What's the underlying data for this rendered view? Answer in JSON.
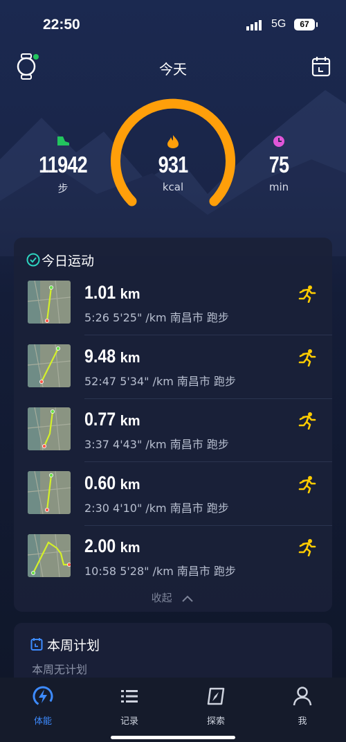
{
  "status_bar": {
    "time": "22:50",
    "network": "5G",
    "battery": "67"
  },
  "header": {
    "title": "今天",
    "left_icon": "watch-icon",
    "right_icon": "calendar-icon"
  },
  "stats": {
    "steps": {
      "value": "11942",
      "unit": "步",
      "color": "#22c55e"
    },
    "calories": {
      "value": "931",
      "unit": "kcal",
      "color": "#ff9f0a"
    },
    "minutes": {
      "value": "75",
      "unit": "min",
      "color": "#e056d8"
    },
    "ring_progress": 0.68
  },
  "today_card": {
    "title": "今日运动",
    "activities": [
      {
        "distance": "1.01",
        "unit": "km",
        "meta": "5:26  5'25\" /km 南昌市 跑步"
      },
      {
        "distance": "9.48",
        "unit": "km",
        "meta": "52:47  5'34\" /km 南昌市 跑步"
      },
      {
        "distance": "0.77",
        "unit": "km",
        "meta": "3:37  4'43\" /km 南昌市 跑步"
      },
      {
        "distance": "0.60",
        "unit": "km",
        "meta": "2:30  4'10\" /km 南昌市 跑步"
      },
      {
        "distance": "2.00",
        "unit": "km",
        "meta": "10:58  5'28\" /km 南昌市 跑步"
      }
    ],
    "collapse_label": "收起"
  },
  "plan_card": {
    "title": "本周计划",
    "subtitle": "本周无计划"
  },
  "tabbar": {
    "items": [
      {
        "label": "体能",
        "icon": "fitness-icon",
        "active": true
      },
      {
        "label": "记录",
        "icon": "list-icon",
        "active": false
      },
      {
        "label": "探索",
        "icon": "compass-icon",
        "active": false
      },
      {
        "label": "我",
        "icon": "profile-icon",
        "active": false
      }
    ]
  },
  "colors": {
    "accent": "#3d8bff",
    "run_icon": "#ffcc00",
    "ring": "#ff9f0a"
  }
}
